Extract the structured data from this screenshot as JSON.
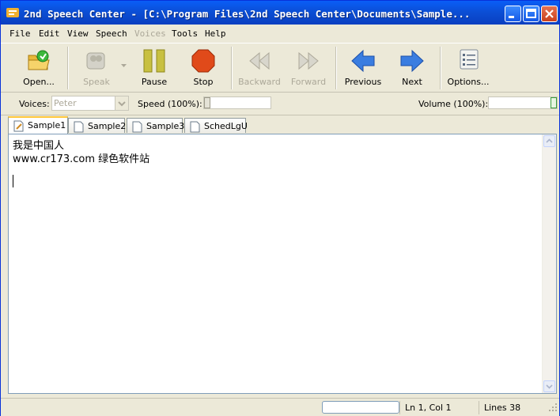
{
  "window": {
    "title": "2nd Speech Center - [C:\\Program Files\\2nd Speech Center\\Documents\\Sample..."
  },
  "menu": [
    {
      "label": "File",
      "disabled": false
    },
    {
      "label": "Edit",
      "disabled": false
    },
    {
      "label": "View",
      "disabled": false
    },
    {
      "label": "Speech",
      "disabled": false
    },
    {
      "label": "Voices",
      "disabled": true
    },
    {
      "label": "Tools",
      "disabled": false
    },
    {
      "label": "Help",
      "disabled": false
    }
  ],
  "toolbar": {
    "open": "Open...",
    "speak": "Speak",
    "pause": "Pause",
    "stop": "Stop",
    "backward": "Backward",
    "forward": "Forward",
    "previous": "Previous",
    "next": "Next",
    "options": "Options..."
  },
  "options": {
    "voices_label": "Voices:",
    "voices_value": "Peter",
    "speed_label": "Speed (100%):",
    "speed_value": 0,
    "volume_label": "Volume (100%):",
    "volume_value": 1
  },
  "tabs": [
    {
      "label": "Sample1",
      "active": true
    },
    {
      "label": "Sample2",
      "active": false
    },
    {
      "label": "Sample3",
      "active": false
    },
    {
      "label": "SchedLgU",
      "active": false
    }
  ],
  "editor": {
    "lines": [
      "我是中国人",
      "www.cr173.com 绿色软件站"
    ]
  },
  "status": {
    "position": "Ln 1, Col 1",
    "lines": "Lines 38"
  },
  "colors": {
    "title_bar": "#0a5ef7",
    "pause_icon": "#c8c040",
    "stop_icon": "#e04a1a",
    "nav_arrow": "#3a7de0"
  }
}
